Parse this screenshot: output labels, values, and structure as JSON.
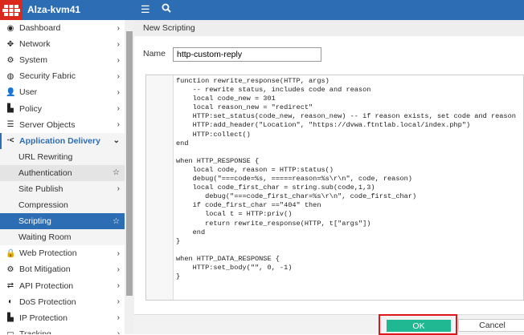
{
  "header": {
    "title": "Alza-kvm41",
    "menu_icon": "hamburger-icon",
    "search_icon": "search-icon",
    "brand_color": "#2d6db4"
  },
  "sidebar": {
    "items": [
      {
        "label": "Dashboard",
        "icon": "◉"
      },
      {
        "label": "Network",
        "icon": "✥"
      },
      {
        "label": "System",
        "icon": "⚙"
      },
      {
        "label": "Security Fabric",
        "icon": "◍"
      },
      {
        "label": "User",
        "icon": "👤"
      },
      {
        "label": "Policy",
        "icon": "▙"
      },
      {
        "label": "Server Objects",
        "icon": "☰"
      },
      {
        "label": "Application Delivery",
        "icon": "⋅<"
      }
    ],
    "subitems": [
      {
        "label": "URL Rewriting"
      },
      {
        "label": "Authentication"
      },
      {
        "label": "Site Publish"
      },
      {
        "label": "Compression"
      },
      {
        "label": "Scripting"
      },
      {
        "label": "Waiting Room"
      }
    ],
    "items2": [
      {
        "label": "Web Protection",
        "icon": "🔒"
      },
      {
        "label": "Bot Mitigation",
        "icon": "⚙"
      },
      {
        "label": "API Protection",
        "icon": "⇄"
      },
      {
        "label": "DoS Protection",
        "icon": "◐"
      },
      {
        "label": "IP Protection",
        "icon": "▙"
      },
      {
        "label": "Tracking",
        "icon": "▭"
      }
    ]
  },
  "panel": {
    "title": "New Scripting",
    "name_label": "Name",
    "name_value": "http-custom-reply",
    "code": "function rewrite_response(HTTP, args)\n    -- rewrite status, includes code and reason\n    local code_new = 301\n    local reason_new = \"redirect\"\n    HTTP:set_status(code_new, reason_new) -- if reason exists, set code and reason\n    HTTP:add_header(\"Location\", \"https://dvwa.ftntlab.local/index.php\")\n    HTTP:collect()\nend\n\nwhen HTTP_RESPONSE {\n    local code, reason = HTTP:status()\n    debug(\"===code=%s, =====reason=%s\\r\\n\", code, reason)\n    local code_first_char = string.sub(code,1,3)\n       debug(\"===code_first_char=%s\\r\\n\", code_first_char)\n    if code_first_char ==\"404\" then\n       local t = HTTP:priv()\n       return rewrite_response(HTTP, t[\"args\"])\n    end\n}\n\nwhen HTTP_DATA_RESPONSE {\n    HTTP:set_body(\"\", 0, -1)\n}"
  },
  "footer": {
    "ok_label": "OK",
    "cancel_label": "Cancel"
  }
}
